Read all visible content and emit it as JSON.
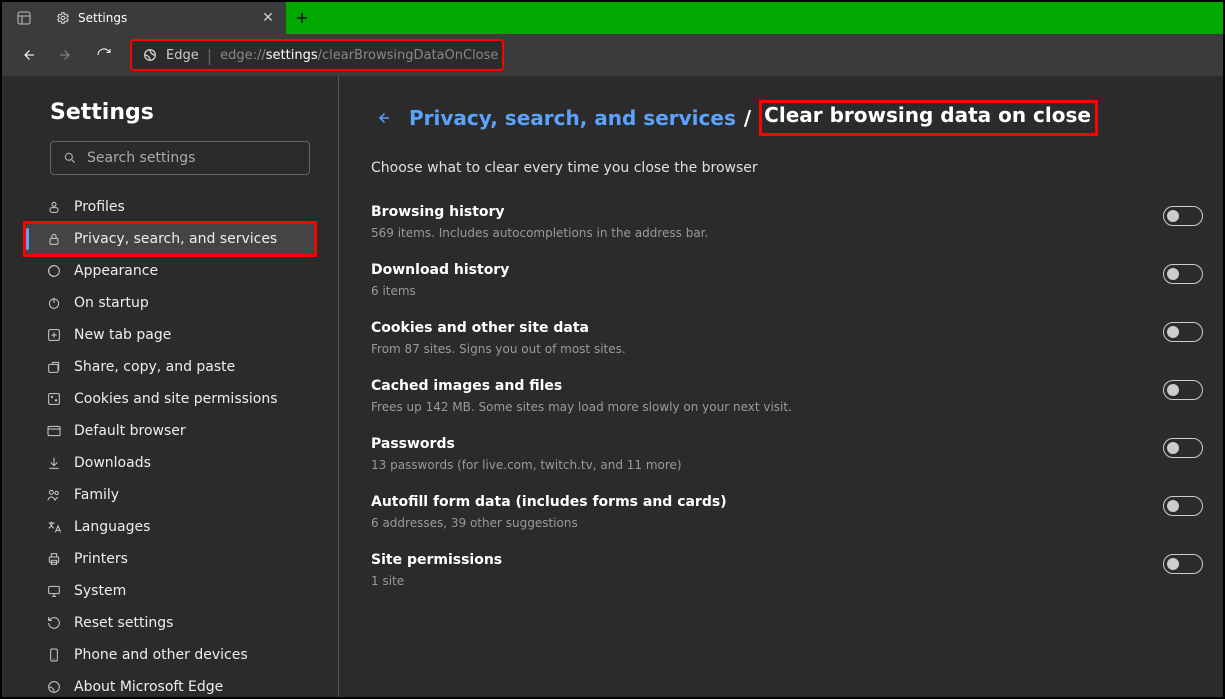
{
  "tab": {
    "title": "Settings"
  },
  "toolbar": {
    "brand": "Edge",
    "url_prefix": "edge://",
    "url_mid": "settings",
    "url_suffix": "/clearBrowsingDataOnClose"
  },
  "sidebar": {
    "heading": "Settings",
    "search_placeholder": "Search settings",
    "items": [
      {
        "label": "Profiles"
      },
      {
        "label": "Privacy, search, and services"
      },
      {
        "label": "Appearance"
      },
      {
        "label": "On startup"
      },
      {
        "label": "New tab page"
      },
      {
        "label": "Share, copy, and paste"
      },
      {
        "label": "Cookies and site permissions"
      },
      {
        "label": "Default browser"
      },
      {
        "label": "Downloads"
      },
      {
        "label": "Family"
      },
      {
        "label": "Languages"
      },
      {
        "label": "Printers"
      },
      {
        "label": "System"
      },
      {
        "label": "Reset settings"
      },
      {
        "label": "Phone and other devices"
      },
      {
        "label": "About Microsoft Edge"
      }
    ]
  },
  "main": {
    "breadcrumb_link": "Privacy, search, and services",
    "breadcrumb_separator": "/",
    "breadcrumb_current": "Clear browsing data on close",
    "subtitle": "Choose what to clear every time you close the browser",
    "options": [
      {
        "title": "Browsing history",
        "desc": "569 items. Includes autocompletions in the address bar."
      },
      {
        "title": "Download history",
        "desc": "6 items"
      },
      {
        "title": "Cookies and other site data",
        "desc": "From 87 sites. Signs you out of most sites."
      },
      {
        "title": "Cached images and files",
        "desc": "Frees up 142 MB. Some sites may load more slowly on your next visit."
      },
      {
        "title": "Passwords",
        "desc": "13 passwords (for live.com, twitch.tv, and 11 more)"
      },
      {
        "title": "Autofill form data (includes forms and cards)",
        "desc": "6 addresses, 39 other suggestions"
      },
      {
        "title": "Site permissions",
        "desc": "1 site"
      }
    ]
  }
}
